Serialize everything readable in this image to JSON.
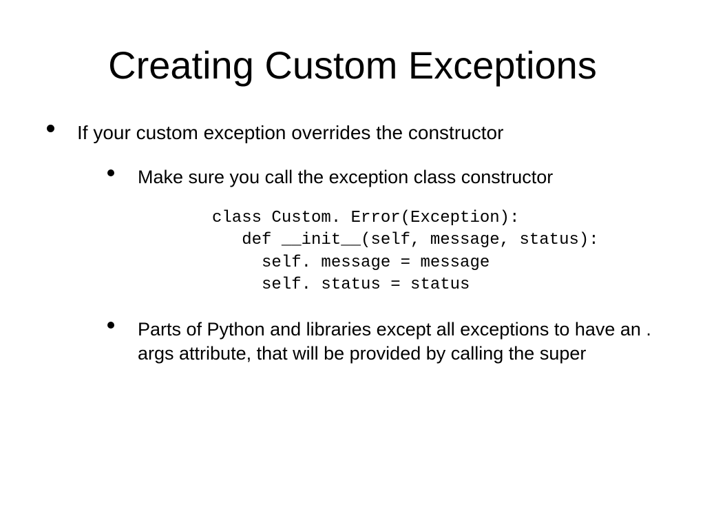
{
  "title": "Creating Custom Exceptions",
  "bullet1": "If your custom exception overrides the constructor",
  "sub1": "Make sure you call the exception class constructor",
  "code": "class Custom. Error(Exception):\n   def __init__(self, message, status):\n     self. message = message\n     self. status = status",
  "sub2": "Parts of Python and libraries except all exceptions to have an . args attribute, that will be provided by calling the super"
}
